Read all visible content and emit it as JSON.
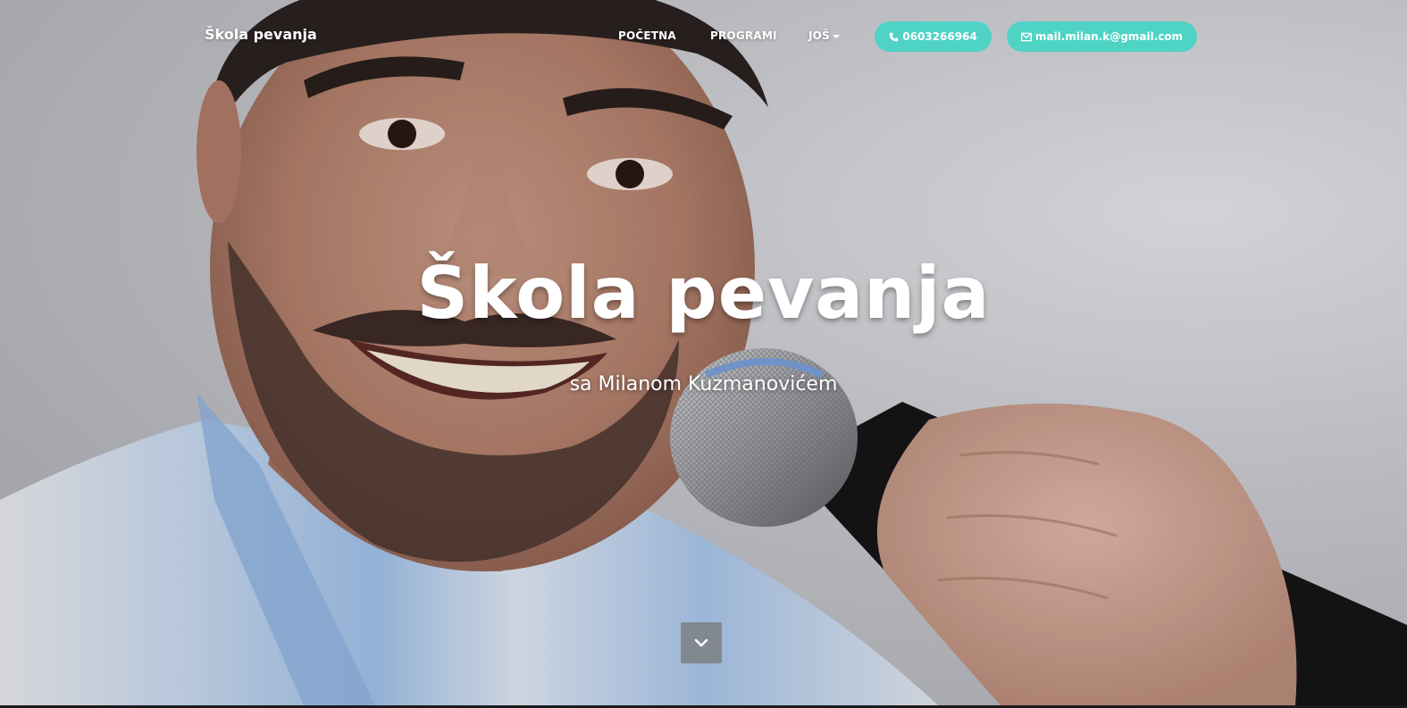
{
  "navbar": {
    "brand": "Škola pevanja",
    "links": [
      {
        "label": "POČETNA"
      },
      {
        "label": "PROGRAMI"
      },
      {
        "label": "JOŠ"
      }
    ],
    "phone": "0603266964",
    "email": "mail.milan.k@gmail.com"
  },
  "hero": {
    "title": "Škola pevanja",
    "subtitle": "sa Milanom Kuzmanovićem"
  },
  "icons": {
    "phone": "phone-icon",
    "email": "envelope-icon",
    "dropdown": "caret-down-icon",
    "scroll": "chevron-down-icon"
  },
  "colors": {
    "accent": "#4fd3c4",
    "text": "#ffffff"
  }
}
